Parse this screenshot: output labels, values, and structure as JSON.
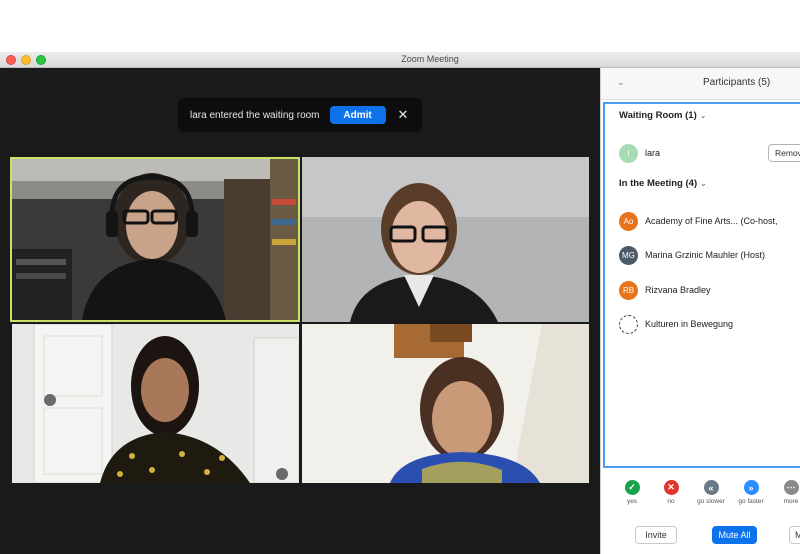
{
  "window": {
    "title": "Zoom Meeting"
  },
  "notification": {
    "text": "lara entered the waiting room",
    "admit_label": "Admit"
  },
  "participants_panel": {
    "title": "Participants (5)",
    "waiting_room": {
      "heading": "Waiting Room (1)",
      "items": [
        {
          "initial": "l",
          "name": "lara",
          "action": "Remove",
          "color": "#a5dcb4"
        }
      ]
    },
    "in_meeting": {
      "heading": "In the Meeting (4)",
      "items": [
        {
          "initials": "Ao",
          "name": "Academy of Fine Arts... (Co-host, ",
          "color": "#e8731b"
        },
        {
          "initials": "MG",
          "name": "Marina Grzinic Mauhler (Host)",
          "color": "#4c5a66"
        },
        {
          "initials": "RB",
          "name": "Rizvana Bradley",
          "color": "#e8731b"
        },
        {
          "initials": "",
          "name": "Kulturen in Bewegung",
          "color": "#ffffff"
        }
      ]
    },
    "reactions": [
      {
        "icon": "check-icon",
        "glyph": "✓",
        "label": "yes",
        "color": "#17a34a"
      },
      {
        "icon": "x-icon",
        "glyph": "✕",
        "label": "no",
        "color": "#e0362c"
      },
      {
        "icon": "rewind-icon",
        "glyph": "«",
        "label": "go slower",
        "color": "#6b7a88"
      },
      {
        "icon": "fast-forward-icon",
        "glyph": "»",
        "label": "go faster",
        "color": "#2d8cff"
      },
      {
        "icon": "more-icon",
        "glyph": "⋯",
        "label": "more",
        "color": "#8a8a8a"
      }
    ],
    "footer": {
      "invite_label": "Invite",
      "mute_all_label": "Mute All",
      "more_label": "M"
    }
  }
}
